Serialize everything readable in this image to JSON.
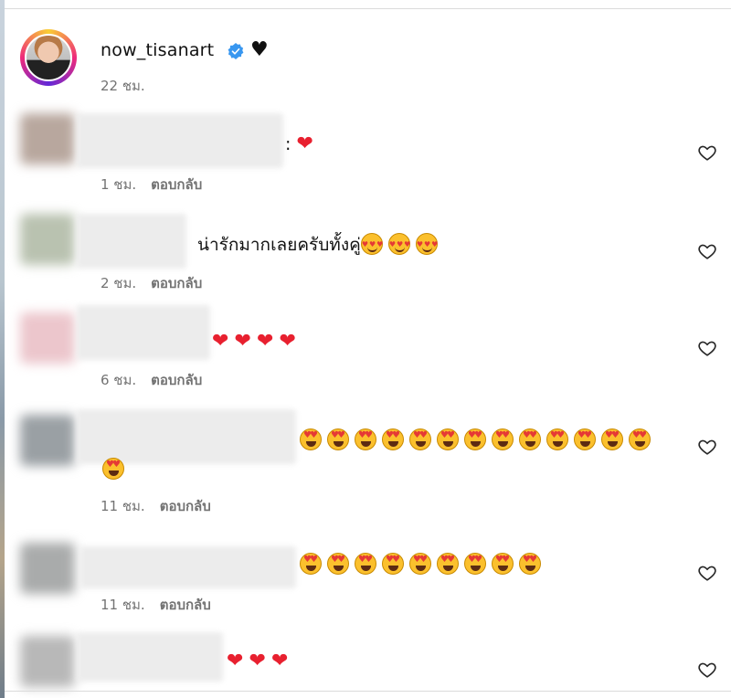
{
  "post": {
    "username": "now_tisanart",
    "time": "22 ชม.",
    "heart_icon": "black-heart-icon",
    "verified_icon": "verified-badge-icon"
  },
  "reply_label": "ตอบกลับ",
  "comments": [
    {
      "text": ":",
      "emojis": [
        "red-heart"
      ],
      "time": "1 ชม."
    },
    {
      "text": "น่ารักมากเลยครับทั้งคู่",
      "emojis": [
        "smiling-face-with-hearts",
        "smiling-face-with-hearts",
        "smiling-face-with-hearts"
      ],
      "time": "2 ชม."
    },
    {
      "text": "",
      "emojis": [
        "red-heart",
        "red-heart",
        "red-heart",
        "red-heart"
      ],
      "time": "6 ชม."
    },
    {
      "text": "",
      "emojis": [
        "heart-eyes",
        "heart-eyes",
        "heart-eyes",
        "heart-eyes",
        "heart-eyes",
        "heart-eyes",
        "heart-eyes",
        "heart-eyes",
        "heart-eyes",
        "heart-eyes",
        "heart-eyes",
        "heart-eyes",
        "heart-eyes",
        "heart-eyes"
      ],
      "time": "11 ชม."
    },
    {
      "text": "",
      "emojis": [
        "heart-eyes",
        "heart-eyes",
        "heart-eyes",
        "heart-eyes",
        "heart-eyes",
        "heart-eyes",
        "heart-eyes",
        "heart-eyes",
        "heart-eyes"
      ],
      "time": "11 ชม."
    },
    {
      "text": "",
      "emojis": [
        "red-heart",
        "red-heart",
        "red-heart"
      ],
      "time": ""
    }
  ],
  "colors": {
    "verified": "#3897f0",
    "meta_text": "#737373",
    "heart_red": "#e8202f"
  }
}
